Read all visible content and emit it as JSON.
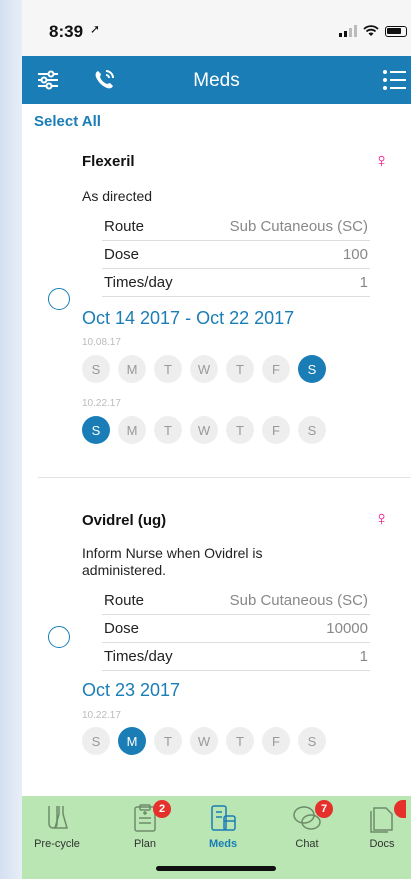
{
  "status": {
    "time": "8:39"
  },
  "header": {
    "title": "Meds"
  },
  "select_all": "Select All",
  "meds": [
    {
      "name": "Flexeril",
      "instructions": "As directed",
      "rows": [
        {
          "label": "Route",
          "value": "Sub Cutaneous (SC)"
        },
        {
          "label": "Dose",
          "value": "100"
        },
        {
          "label": "Times/day",
          "value": "1"
        }
      ],
      "date_range": "Oct 14 2017 - Oct 22 2017",
      "weeks": [
        {
          "label": "10.08.17",
          "days": [
            "S",
            "M",
            "T",
            "W",
            "T",
            "F",
            "S"
          ]
        },
        {
          "label": "10.22.17",
          "days": [
            "S",
            "M",
            "T",
            "W",
            "T",
            "F",
            "S"
          ]
        }
      ]
    },
    {
      "name": "Ovidrel (ug)",
      "instructions": "Inform Nurse when Ovidrel is administered.",
      "rows": [
        {
          "label": "Route",
          "value": "Sub Cutaneous (SC)"
        },
        {
          "label": "Dose",
          "value": "10000"
        },
        {
          "label": "Times/day",
          "value": "1"
        }
      ],
      "date_range": "Oct 23 2017",
      "weeks": [
        {
          "label": "10.22.17",
          "days": [
            "S",
            "M",
            "T",
            "W",
            "T",
            "F",
            "S"
          ]
        }
      ]
    }
  ],
  "tabs": [
    {
      "label": "Pre-cycle",
      "icon": "flask-icon"
    },
    {
      "label": "Plan",
      "icon": "clipboard-icon",
      "badge": "2"
    },
    {
      "label": "Meds",
      "icon": "meds-icon"
    },
    {
      "label": "Chat",
      "icon": "chat-icon",
      "badge": "7"
    },
    {
      "label": "Docs",
      "icon": "docs-icon"
    }
  ],
  "colors": {
    "accent": "#1a7db6",
    "female": "#e8158b",
    "tabbar": "#b9e6b2",
    "badge": "#e5302b"
  }
}
